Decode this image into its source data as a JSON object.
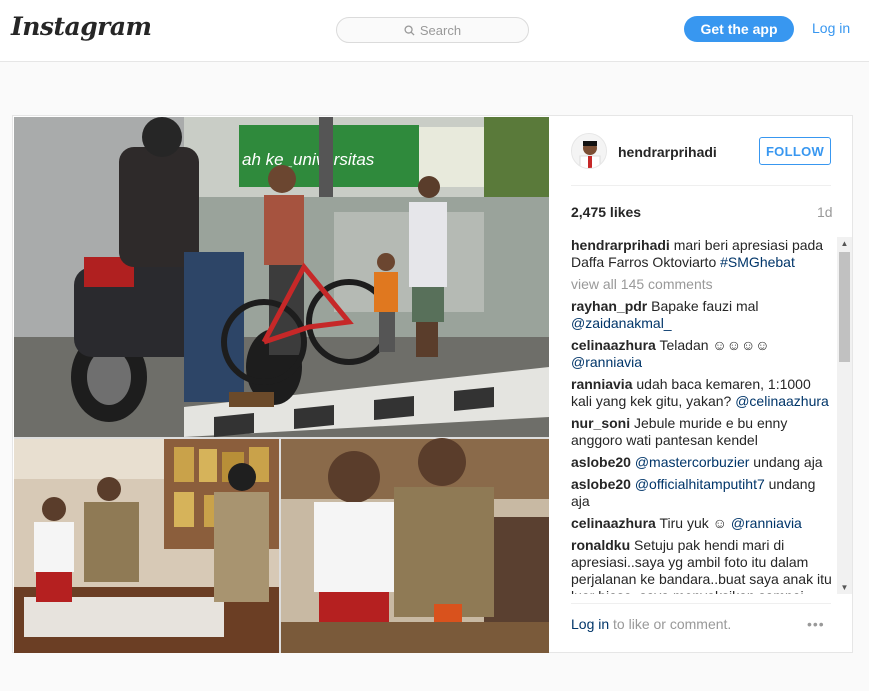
{
  "header": {
    "logo": "Instagram",
    "search_placeholder": "Search",
    "get_app_label": "Get the app",
    "login_label": "Log in"
  },
  "post": {
    "username": "hendrarprihadi",
    "follow_label": "FOLLOW",
    "likes": "2,475 likes",
    "age": "1d",
    "caption": {
      "user": "hendrarprihadi",
      "text": "mari beri apresiasi pada Daffa Farros Oktoviarto",
      "tag": "#SMGhebat"
    },
    "view_all": "view all 145 comments",
    "comments": [
      {
        "user": "rayhan_pdr",
        "text": "Bapake fauzi mal",
        "tag": "@zaidanakmal_",
        "after": ""
      },
      {
        "user": "celinaazhura",
        "text": "Teladan ☺☺☺☺",
        "tag": "@ranniavia",
        "after": ""
      },
      {
        "user": "ranniavia",
        "text": "udah baca kemaren, 1:1000 kali yang kek gitu, yakan?",
        "tag": "@celinaazhura",
        "after": ""
      },
      {
        "user": "nur_soni",
        "text": "Jebule muride e bu enny anggoro wati pantesan kendel",
        "tag": "",
        "after": ""
      },
      {
        "user": "aslobe20",
        "text": "",
        "tag": "@mastercorbuzier",
        "after": "undang aja"
      },
      {
        "user": "aslobe20",
        "text": "",
        "tag": "@officialhitamputiht7",
        "after": "undang aja"
      },
      {
        "user": "celinaazhura",
        "text": "Tiru yuk ☺",
        "tag": "@ranniavia",
        "after": ""
      },
      {
        "user": "ronaldku",
        "text": "Setuju pak hendi mari di apresiasi..saya yg ambil foto itu dalam perjalanan ke bandara..buat saya anak itu luar biasa..saya menyaksikan sampai",
        "tag": "",
        "after": ""
      }
    ],
    "login_prompt_link": "Log in",
    "login_prompt_text": "to like or comment.",
    "more_options": "•••",
    "photo_sign_text": "ah ke_universitas"
  }
}
